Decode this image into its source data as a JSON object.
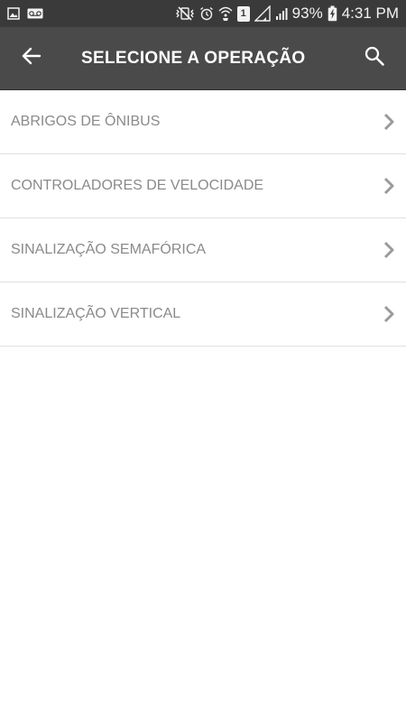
{
  "status_bar": {
    "battery_percent": "93%",
    "time": "4:31 PM",
    "sim_slot": "1",
    "icons": [
      "image-icon",
      "voicemail-icon",
      "mute-vibrate-icon",
      "alarm-icon",
      "wifi-calling-icon",
      "sim-icon",
      "signal-icon",
      "signal-roaming-icon",
      "battery-charging-icon"
    ]
  },
  "app_bar": {
    "title": "SELECIONE A OPERAÇÃO",
    "back_icon": "arrow-left-icon",
    "search_icon": "search-icon"
  },
  "operations": [
    {
      "label": "ABRIGOS DE ÔNIBUS"
    },
    {
      "label": "CONTROLADORES DE VELOCIDADE"
    },
    {
      "label": "SINALIZAÇÃO SEMAFÓRICA"
    },
    {
      "label": "SINALIZAÇÃO VERTICAL"
    }
  ],
  "colors": {
    "status_bar_bg": "#3a3a3a",
    "app_bar_bg": "#4a4a4a",
    "item_text": "#8a8a8a",
    "chevron": "#9a9a9a",
    "divider": "#e0e0e0"
  }
}
